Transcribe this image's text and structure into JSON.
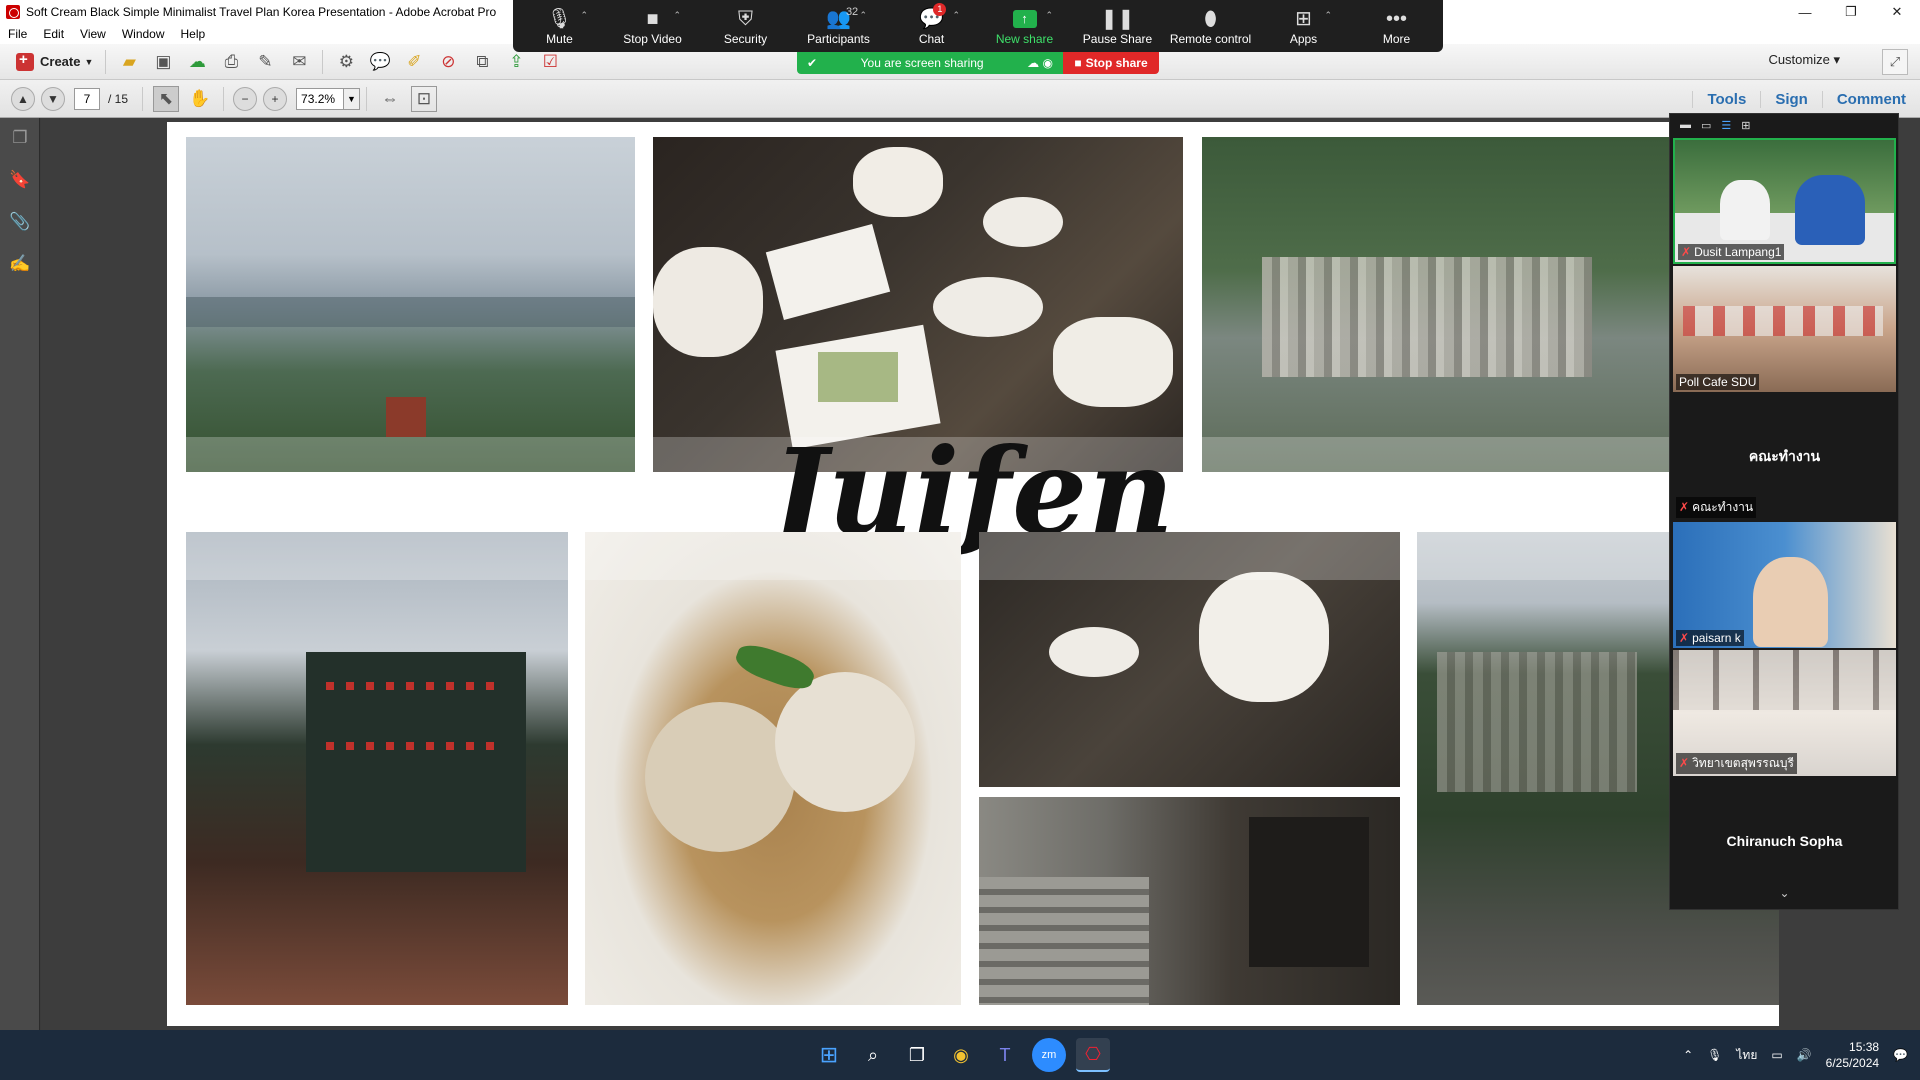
{
  "window": {
    "title": "Soft Cream Black Simple Minimalist Travel Plan Korea Presentation - Adobe Acrobat Pro",
    "controls": [
      "—",
      "❐",
      "✕"
    ]
  },
  "menubar": [
    "File",
    "Edit",
    "View",
    "Window",
    "Help"
  ],
  "toolbar": {
    "create_label": "Create",
    "customize_label": "Customize"
  },
  "navbar": {
    "current_page": "7",
    "total_pages": "/ 15",
    "zoom_value": "73.2%",
    "tabs": [
      "Tools",
      "Sign",
      "Comment"
    ]
  },
  "slide": {
    "title": "Juifen"
  },
  "zoom": {
    "items": [
      {
        "label": "Mute",
        "icon": "microphone-icon"
      },
      {
        "label": "Stop Video",
        "icon": "video-camera-icon"
      },
      {
        "label": "Security",
        "icon": "shield-icon"
      },
      {
        "label": "Participants",
        "icon": "people-icon",
        "count": "32"
      },
      {
        "label": "Chat",
        "icon": "chat-icon",
        "badge": "1"
      },
      {
        "label": "New share",
        "icon": "share-up-icon"
      },
      {
        "label": "Pause Share",
        "icon": "pause-icon"
      },
      {
        "label": "Remote control",
        "icon": "mouse-icon"
      },
      {
        "label": "Apps",
        "icon": "apps-icon"
      },
      {
        "label": "More",
        "icon": "more-icon"
      }
    ],
    "sharing_text": "You are screen sharing",
    "stop_share": "Stop share",
    "participants": [
      {
        "name": "Dusit Lampang1"
      },
      {
        "name": "Poll Cafe SDU"
      },
      {
        "name": "คณะทำงาน",
        "label": "คณะทำงาน"
      },
      {
        "name": "paisarn k"
      },
      {
        "name": "วิทยาเขตสุพรรณบุรี"
      },
      {
        "name": "Chiranuch Sopha"
      }
    ]
  },
  "taskbar": {
    "time": "15:38",
    "date": "6/25/2024",
    "lang": "ไทย"
  },
  "colors": {
    "zoom_green": "#22b14c",
    "zoom_red": "#e02828",
    "acrobat_blue": "#2a6eb0"
  }
}
